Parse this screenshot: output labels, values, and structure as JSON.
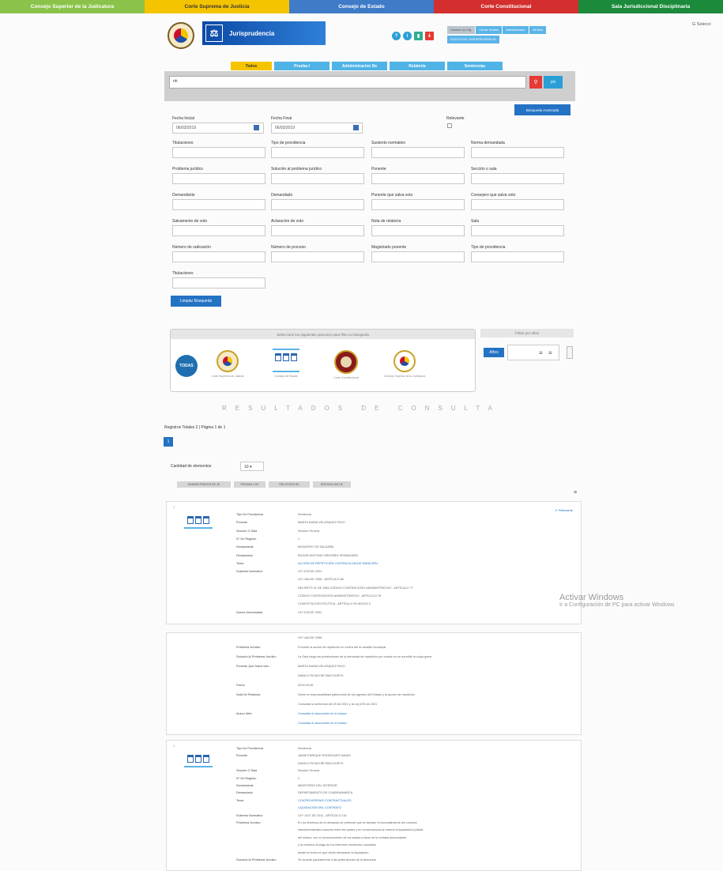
{
  "top_nav": [
    {
      "label": "Consejo Superior de la Judicatura",
      "color": "#8bc34a",
      "text": "#ffffff"
    },
    {
      "label": "Corte Suprema de Justicia",
      "color": "#f5c400",
      "text": "#333333"
    },
    {
      "label": "Consejo de Estado",
      "color": "#3f7bc6",
      "text": "#ffffff"
    },
    {
      "label": "Corte Constitucional",
      "color": "#d32f2f",
      "text": "#ffffff"
    },
    {
      "label": "Sala Jurisdiccional Disciplinaria",
      "color": "#1b8a3a",
      "text": "#ffffff"
    }
  ],
  "translate": {
    "label": "G Selecci"
  },
  "header": {
    "banner_title": "Jurisprudencia",
    "icons": [
      {
        "name": "help-icon",
        "glyph": "?",
        "color": "#2a9fd6"
      },
      {
        "name": "info-icon",
        "glyph": "i",
        "color": "#2a9fd6"
      },
      {
        "name": "document-icon",
        "glyph": "▮",
        "color": "#2eaf8f"
      },
      {
        "name": "pdf-icon",
        "glyph": "⤓",
        "color": "#e53935"
      }
    ],
    "user_buttons": [
      "Usuario no reg.",
      "Cerrar Sesión",
      "Administrador",
      "Verifica",
      "SOLICITUD JURISPRUDENCIA"
    ]
  },
  "search_tabs": [
    "Todos",
    "Prueba I",
    "Administracion De",
    "Relatoria",
    "Sentencias"
  ],
  "search": {
    "value": "nh",
    "search_icon": "search-icon",
    "voice_label": "y/o"
  },
  "advanced_button": "Búsqueda Avanzada",
  "dates": {
    "start_label": "Fecha Inicial",
    "start_value": "06/03/2019",
    "end_label": "Fecha Final",
    "end_value": "06/03/2019",
    "relevant_label": "Relevante"
  },
  "filters": [
    "Titulaciones",
    "Tipo de providencia",
    "Sustento normativo",
    "Norma demandada",
    "Problema jurídico",
    "Solución al problema jurídico",
    "Ponente",
    "Sección o sala",
    "Demandante",
    "Demandado",
    "Ponente que salva voto",
    "Consejero que salva voto",
    "Salvamento de voto",
    "Aclaración de voto",
    "Nota de relatoría",
    "Sala",
    "Número de radicación",
    "Número de proceso",
    "Magistrado ponente",
    "Tipo de providencia",
    "Titulaciones"
  ],
  "clear_button": "Limpiar Búsqueda",
  "entity_box": {
    "caption": "Seleccione los siguientes opciones para filtro su búsqueda",
    "todos": "TODAS",
    "entities": [
      "Corte Suprema de Justicia",
      "Consejo de Estado",
      "Corte Constitucional",
      "Consejo Superior de la Judicatura"
    ]
  },
  "years_box": {
    "caption": "Filtrar por años",
    "button": "Años"
  },
  "results_title": "RESULTADOS DE CONSULTA",
  "results_total": "Registros Totales 2 | Página 1 de 1",
  "page_number": "1",
  "quantity": {
    "label": "Cantidad de elementos",
    "value": "10 ▾"
  },
  "pills": [
    "ADMINISTRADOR DE JD",
    "PRUEBA 1 DE",
    "RELATORIA DE",
    "SENTENCIAS DE"
  ],
  "card1": {
    "badge": "✔ Relevante",
    "rows": [
      {
        "k": "Tipo De Providencia",
        "v": "Sentencia"
      },
      {
        "k": "Ponente",
        "v": "MARTA NUBIA VELASQUEZ RICO"
      },
      {
        "k": "Sección O Sala",
        "v": "Sección Tercera"
      },
      {
        "k": "N° De Registro",
        "v": "1"
      },
      {
        "k": "Demandante",
        "v": "MUNICIPIO DE SALDAÑA"
      },
      {
        "k": "Demandado",
        "v": "EDGAR ANTONIO ORDOÑEZ HERNANDEZ"
      },
      {
        "k": "Tema",
        "v": "ACCIÓN DE REPETICIÓN CONTRA ALCALDE MUNICIPAL",
        "link": true
      },
      {
        "k": "Sustento Normativo",
        "v": "LEY 678 DE 2001"
      },
      {
        "k": "",
        "v": "LEY 446 DE 1998 - ARTÍCULO 86"
      },
      {
        "k": "",
        "v": "DECRETO 01 DE 1984 CÓDIGO CONTENCIOSO ADMINISTRATIVO - ARTÍCULO 77"
      },
      {
        "k": "",
        "v": "CÓDIGO CONTENCIOSO ADMINISTRATIVO - ARTÍCULO 78"
      },
      {
        "k": "",
        "v": "CONSTITUCIÓN POLÍTICA - ARTÍCULO 90 INCISO 2"
      },
      {
        "k": "Norma Demandada",
        "v": "LEY 678 DE 2001"
      }
    ]
  },
  "card1b": {
    "rows": [
      {
        "k": "",
        "v": "LEY 446 DE 1998"
      },
      {
        "k": "Problema Jurídico",
        "v": "Procede la acción de repetición en contra del ex alcalde municipal"
      },
      {
        "k": "Solución Al Problema Jurídico",
        "v": "La Sala niega las pretensiones de la demanda de repetición por cuanto no se acreditó la culpa grave"
      },
      {
        "k": "Ponente Que Salva Voto",
        "v": "MARTA NUBIA VELASQUEZ RICO"
      },
      {
        "k": "",
        "v": "DANILO ROJAS BETANCOURTH"
      },
      {
        "k": "Fecha",
        "v": "2019-03-06"
      },
      {
        "k": "Nota De Relatoría",
        "v": "Sobre la responsabilidad patrimonial de los agentes del Estado y la acción de repetición"
      },
      {
        "k": "",
        "v": "Consultar la sentencia del 29 de 2001 y la Ley 678 de 2001"
      },
      {
        "k": "Anexo Web",
        "v": "Consultar el documento en el enlace",
        "link": true
      },
      {
        "k": "",
        "v": "Consultar el documento en el enlace",
        "link": true
      }
    ]
  },
  "card2": {
    "rows": [
      {
        "k": "Tipo De Providencia",
        "v": "Sentencia"
      },
      {
        "k": "Ponente",
        "v": "JAIME ENRIQUE RODRIGUEZ NAVAS"
      },
      {
        "k": "",
        "v": "DANILO ROJAS BETANCOURTH"
      },
      {
        "k": "Sección O Sala",
        "v": "Sección Tercera"
      },
      {
        "k": "N° De Registro",
        "v": "2"
      },
      {
        "k": "Demandante",
        "v": "MINISTERIO DEL INTERIOR"
      },
      {
        "k": "Demandado",
        "v": "DEPARTAMENTO DE CUNDINAMARCA"
      },
      {
        "k": "Tema",
        "v": "CONTROVERSIAS CONTRACTUALES",
        "link": true
      },
      {
        "k": "",
        "v": "LIQUIDACIÓN DEL CONTRATO",
        "link": true
      },
      {
        "k": "Sustento Normativo",
        "v": "LEY 1437 DE 2011 - ARTÍCULO 141"
      },
      {
        "k": "Problema Jurídico",
        "v": "En los términos de la demanda se pretende que se declare el incumplimiento del contrato"
      },
      {
        "k": "",
        "v": "interadministrativo suscrito entre las partes y en consecuencia se ordene la liquidación judicial"
      },
      {
        "k": "",
        "v": "del mismo, con el reconocimiento de los saldos a favor de la entidad demandante"
      },
      {
        "k": "",
        "v": "y la condena al pago de los intereses moratorios causados"
      },
      {
        "k": "",
        "v": "desde la fecha en que debió efectuarse la liquidación"
      },
      {
        "k": "Solución Al Problema Jurídico",
        "v": "Se accede parcialmente a las pretensiones de la demanda"
      }
    ]
  },
  "watermark": {
    "line1": "Activar Windows",
    "line2": "Ir a Configuración de PC para activar Windows"
  }
}
